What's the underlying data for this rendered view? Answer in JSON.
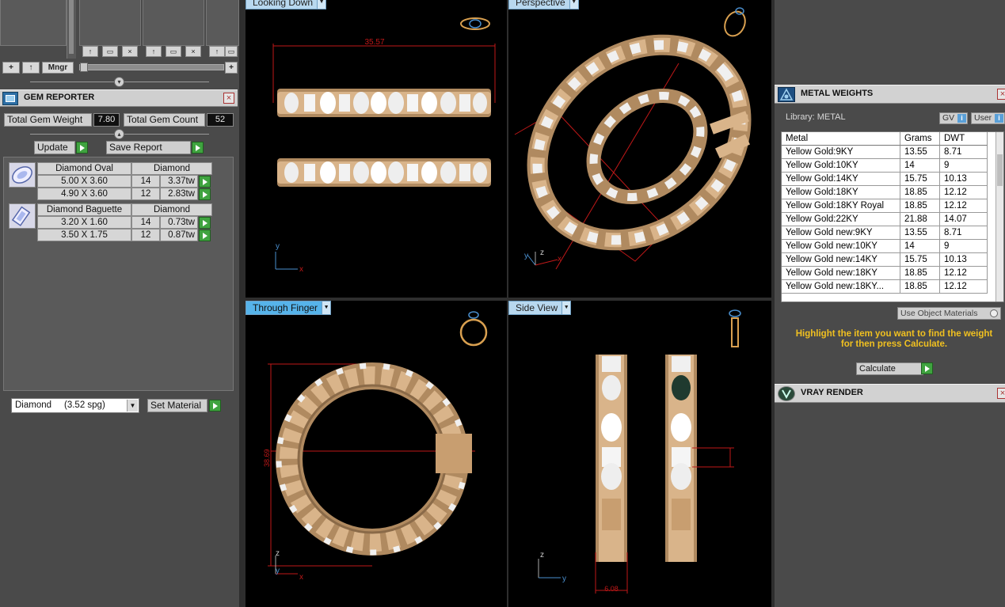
{
  "left_panel": {
    "toolbar": {
      "add": "+",
      "up": "↑",
      "manager": "Mngr",
      "plus": "+"
    },
    "swatch_icons": {
      "up": "↑",
      "save": "▭",
      "close": "×"
    },
    "gem_reporter": {
      "title": "GEM REPORTER",
      "total_weight_label": "Total Gem Weight",
      "total_weight_value": "7.80",
      "total_count_label": "Total Gem Count",
      "total_count_value": "52",
      "update_label": "Update",
      "save_report_label": "Save Report",
      "groups": [
        {
          "icon": "oval-diamond-icon",
          "shape": "Diamond Oval",
          "material": "Diamond",
          "rows": [
            {
              "size": "5.00 X 3.60",
              "count": "14",
              "weight": "3.37tw"
            },
            {
              "size": "4.90 X 3.60",
              "count": "12",
              "weight": "2.83tw"
            }
          ]
        },
        {
          "icon": "baguette-diamond-icon",
          "shape": "Diamond Baguette",
          "material": "Diamond",
          "rows": [
            {
              "size": "3.20 X 1.60",
              "count": "14",
              "weight": "0.73tw"
            },
            {
              "size": "3.50 X 1.75",
              "count": "12",
              "weight": "0.87tw"
            }
          ]
        }
      ],
      "material_select": "Diamond     (3.52 spg)",
      "set_material_label": "Set Material"
    }
  },
  "viewports": {
    "top_left": {
      "tab": "Looking Down",
      "dimension": "35.57",
      "axis_y": "y",
      "axis_x": "x"
    },
    "top_right": {
      "tab": "Perspective",
      "axis_y": "y",
      "axis_z": "z",
      "axis_x": "x"
    },
    "bottom_left": {
      "tab": "Through Finger",
      "dimension": "38.69",
      "axis_z": "z",
      "axis_y": "y",
      "axis_x": "x"
    },
    "bottom_right": {
      "tab": "Side View",
      "dimension": "6.08",
      "axis_z": "z",
      "axis_y": "y"
    }
  },
  "right_panel": {
    "metal_weights": {
      "title": "METAL WEIGHTS",
      "library_label": "Library: METAL",
      "gv_label": "GV",
      "user_label": "User",
      "columns": [
        "Metal",
        "Grams",
        "DWT"
      ],
      "rows": [
        [
          "Yellow Gold:9KY",
          "13.55",
          "8.71"
        ],
        [
          "Yellow Gold:10KY",
          "14",
          "9"
        ],
        [
          "Yellow Gold:14KY",
          "15.75",
          "10.13"
        ],
        [
          "Yellow Gold:18KY",
          "18.85",
          "12.12"
        ],
        [
          "Yellow Gold:18KY Royal",
          "18.85",
          "12.12"
        ],
        [
          "Yellow Gold:22KY",
          "21.88",
          "14.07"
        ],
        [
          "Yellow Gold new:9KY",
          "13.55",
          "8.71"
        ],
        [
          "Yellow Gold new:10KY",
          "14",
          "9"
        ],
        [
          "Yellow Gold new:14KY",
          "15.75",
          "10.13"
        ],
        [
          "Yellow Gold new:18KY",
          "18.85",
          "12.12"
        ],
        [
          "Yellow Gold new:18KY...",
          "18.85",
          "12.12"
        ]
      ],
      "use_object_materials": "Use Object Materials",
      "hint": "Highlight the item you want to find the weight for then press Calculate.",
      "calculate_label": "Calculate"
    },
    "vray": {
      "title": "VRAY RENDER"
    }
  },
  "colors": {
    "gold": "#d9b48a",
    "dimension_red": "#c01818",
    "hint_yellow": "#f0c020",
    "go_green": "#3fa33f",
    "active_tab": "#56b3ea"
  }
}
